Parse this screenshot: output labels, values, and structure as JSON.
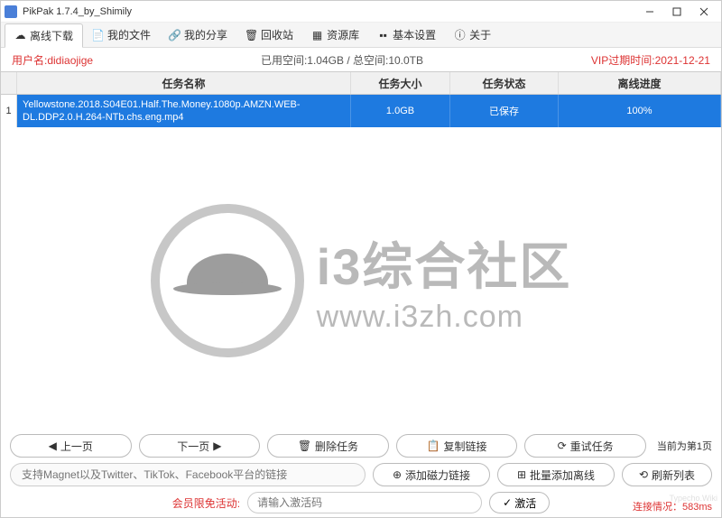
{
  "window": {
    "title": "PikPak 1.7.4_by_Shimily"
  },
  "tabs": [
    {
      "label": "离线下载",
      "icon": "cloud-download"
    },
    {
      "label": "我的文件",
      "icon": "file"
    },
    {
      "label": "我的分享",
      "icon": "share"
    },
    {
      "label": "回收站",
      "icon": "trash"
    },
    {
      "label": "资源库",
      "icon": "library"
    },
    {
      "label": "基本设置",
      "icon": "settings"
    },
    {
      "label": "关于",
      "icon": "info"
    }
  ],
  "infobar": {
    "user_label": "用户名:didiaojige",
    "space_label": "已用空间:1.04GB / 总空间:10.0TB",
    "vip_label": "VIP过期时间:2021-12-21"
  },
  "columns": {
    "name": "任务名称",
    "size": "任务大小",
    "status": "任务状态",
    "progress": "离线进度"
  },
  "rows": [
    {
      "idx": "1",
      "name": "Yellowstone.2018.S04E01.Half.The.Money.1080p.AMZN.WEB-DL.DDP2.0.H.264-NTb.chs.eng.mp4",
      "size": "1.0GB",
      "status": "已保存",
      "progress": "100%"
    }
  ],
  "watermark": {
    "title": "i3综合社区",
    "url": "www.i3zh.com"
  },
  "nav_buttons": {
    "prev": "上一页",
    "next": "下一页",
    "delete": "删除任务",
    "copy": "复制链接",
    "retry": "重试任务",
    "page_info": "当前为第1页"
  },
  "link_row": {
    "placeholder": "支持Magnet以及Twitter、TikTok、Facebook平台的链接",
    "add_magnet": "添加磁力链接",
    "batch_add": "批量添加离线",
    "refresh": "刷新列表"
  },
  "activate": {
    "label": "会员限免活动:",
    "placeholder": "请输入激活码",
    "button": "激活"
  },
  "status": {
    "conn": "连接情况：583ms"
  },
  "footer_mark": "Typecho.Wiki"
}
